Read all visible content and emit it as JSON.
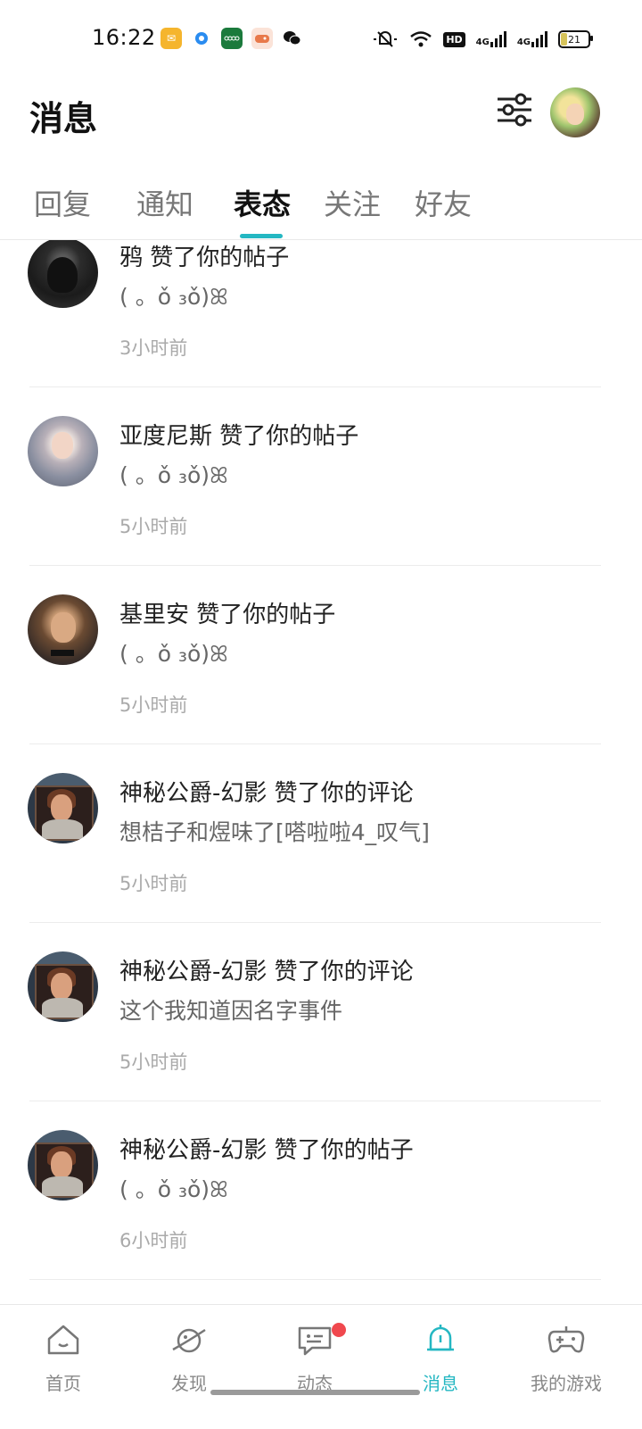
{
  "status_bar": {
    "time": "16:22",
    "apps": [
      {
        "name": "mail-app-icon",
        "color": "#f5b52d"
      },
      {
        "name": "browser-app-icon",
        "color": "#2a8cf0"
      },
      {
        "name": "oppo-app-icon",
        "color": "#1b7a3c"
      },
      {
        "name": "game-app-icon",
        "color": "#e8794a"
      },
      {
        "name": "wechat-app-icon",
        "color": "#111111"
      }
    ],
    "hd_label": "HD",
    "network_1": "4G",
    "network_2": "4G",
    "battery": "21",
    "battery_fraction": 0.21
  },
  "header": {
    "title": "消息"
  },
  "tabs": [
    {
      "label": "回复"
    },
    {
      "label": "通知"
    },
    {
      "label": "表态",
      "active": true
    },
    {
      "label": "关注"
    },
    {
      "label": "好友"
    }
  ],
  "notifications": [
    {
      "title": "鸦 赞了你的帖子",
      "content": "( 。ǒ ₃ǒ)ꕤ",
      "time": "3小时前"
    },
    {
      "title": "亚度尼斯 赞了你的帖子",
      "content": "( 。ǒ ₃ǒ)ꕤ",
      "time": "5小时前"
    },
    {
      "title": "基里安 赞了你的帖子",
      "content": "( 。ǒ ₃ǒ)ꕤ",
      "time": "5小时前"
    },
    {
      "title": "神秘公爵-幻影 赞了你的评论",
      "content": "想桔子和煜味了[嗒啦啦4_叹气]",
      "time": "5小时前"
    },
    {
      "title": "神秘公爵-幻影 赞了你的评论",
      "content": "这个我知道因名字事件",
      "time": "5小时前"
    },
    {
      "title": "神秘公爵-幻影 赞了你的帖子",
      "content": "( 。ǒ ₃ǒ)ꕤ",
      "time": "6小时前"
    }
  ],
  "bottom_nav": [
    {
      "label": "首页",
      "icon": "home-icon"
    },
    {
      "label": "发现",
      "icon": "discover-planet-icon"
    },
    {
      "label": "动态",
      "icon": "feed-chat-icon",
      "badge": true
    },
    {
      "label": "消息",
      "icon": "bell-icon",
      "active": true
    },
    {
      "label": "我的游戏",
      "icon": "gamepad-icon"
    }
  ],
  "colors": {
    "accent": "#24b7c2",
    "badge": "#f0484e"
  }
}
